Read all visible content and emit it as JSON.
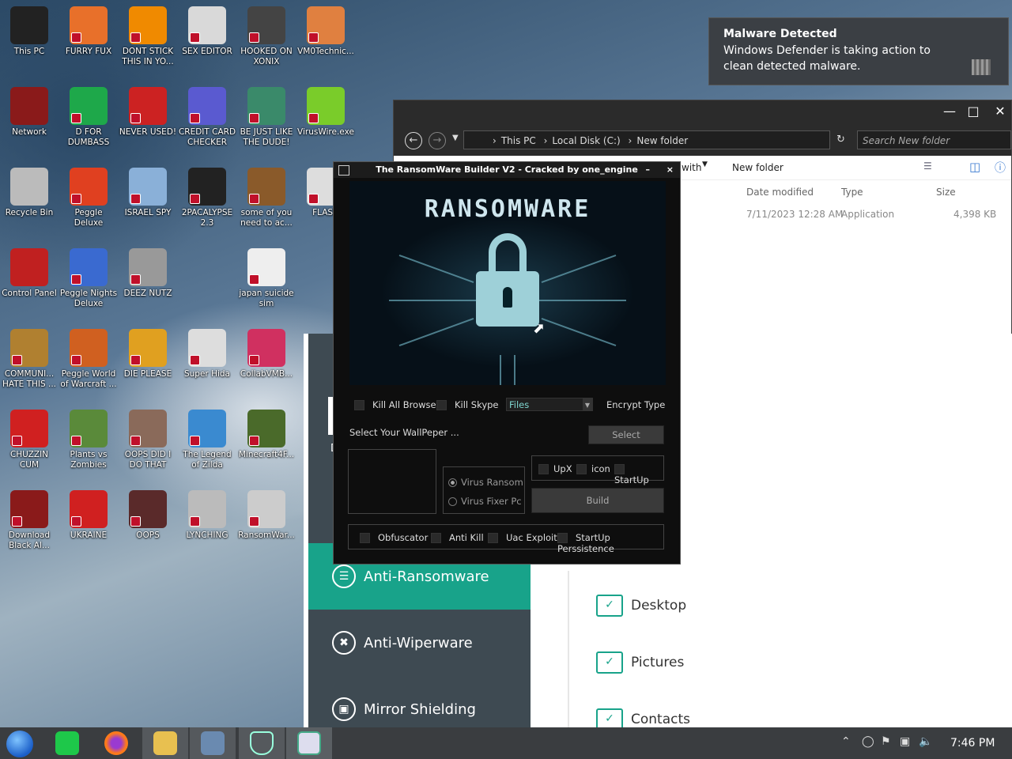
{
  "desktop_icons": [
    {
      "label": "This PC",
      "color": "#222"
    },
    {
      "label": "FURRY FUX",
      "color": "#e8702a"
    },
    {
      "label": "DONT STICK THIS IN YO...",
      "color": "#f08a00"
    },
    {
      "label": "SEX EDITOR",
      "color": "#d9d9d9"
    },
    {
      "label": "HOOKED ON XONIX",
      "color": "#444"
    },
    {
      "label": "VM0Technic...",
      "color": "#e08040"
    },
    {
      "label": "Network",
      "color": "#8a1a1a"
    },
    {
      "label": "D FOR DUMBASS",
      "color": "#1ea84a"
    },
    {
      "label": "NEVER USED!",
      "color": "#cc2222"
    },
    {
      "label": "CREDIT CARD CHECKER",
      "color": "#5a5ad0"
    },
    {
      "label": "BE JUST LIKE THE DUDE!",
      "color": "#3a8a6a"
    },
    {
      "label": "VirusWire.exe",
      "color": "#7acc2a"
    },
    {
      "label": "Recycle Bin",
      "color": "#bbb"
    },
    {
      "label": "Peggle Deluxe",
      "color": "#e04020"
    },
    {
      "label": "ISRAEL SPY",
      "color": "#8ab0d8"
    },
    {
      "label": "2PACALYPSE 2.3",
      "color": "#222"
    },
    {
      "label": "some of you need to ac...",
      "color": "#8a5a2a"
    },
    {
      "label": "FLASH",
      "color": "#ddd"
    },
    {
      "label": "Control Panel",
      "color": "#c02020"
    },
    {
      "label": "Peggle Nights Deluxe",
      "color": "#3a6ad0"
    },
    {
      "label": "DEEZ NUTZ",
      "color": "#999"
    },
    {
      "label": "japan suicide sim",
      "color": "#eee"
    },
    {
      "label": "COMMUNI... HATE THIS ...",
      "color": "#b08030"
    },
    {
      "label": "Peggle World of Warcraft ...",
      "color": "#d06020"
    },
    {
      "label": "DIE PLEASE",
      "color": "#e0a020"
    },
    {
      "label": "Super Hida",
      "color": "#ddd"
    },
    {
      "label": "CollabVMB...",
      "color": "#d03060"
    },
    {
      "label": "CHUZZIN CUM",
      "color": "#d02020"
    },
    {
      "label": "Plants vs Zombies",
      "color": "#5a8a3a"
    },
    {
      "label": "OOPS DID I DO THAT",
      "color": "#8a6a5a"
    },
    {
      "label": "The Legend of Zilda",
      "color": "#3a8ad0"
    },
    {
      "label": "Minecraft4F...",
      "color": "#4a6a2a"
    },
    {
      "label": "Download Black Al...",
      "color": "#8a1a1a"
    },
    {
      "label": "UKRAINE",
      "color": "#d02020"
    },
    {
      "label": "OOPS",
      "color": "#5a2a2a"
    },
    {
      "label": "LYNCHING",
      "color": "#bbb"
    },
    {
      "label": "RansomWar...",
      "color": "#ccc"
    }
  ],
  "toast": {
    "title": "Malware Detected",
    "body": "Windows Defender is taking action to clean detected malware."
  },
  "explorer": {
    "path": [
      "This PC",
      "Local Disk (C:)",
      "New folder"
    ],
    "search_placeholder": "Search New folder",
    "cmd_with": "with",
    "cmd_newfolder": "New folder",
    "columns": {
      "date": "Date modified",
      "type": "Type",
      "size": "Size"
    },
    "file": {
      "date": "7/11/2023 12:28 AM",
      "type": "Application",
      "size": "4,398 KB"
    }
  },
  "defender": {
    "sidebar": [
      {
        "label": "Anti-Ransomware",
        "icon": "document-shield-icon"
      },
      {
        "label": "Anti-Wiperware",
        "icon": "wiper-icon"
      },
      {
        "label": "Mirror Shielding",
        "icon": "mirror-icon"
      }
    ],
    "cut_label": "D",
    "folders": [
      "Desktop",
      "Pictures",
      "Contacts"
    ]
  },
  "ransomware": {
    "title": "The RansomWare Builder V2 - Cracked by one_engine",
    "banner_title": "RANSOMWARE",
    "kill_all_browser": "Kill All Browser",
    "kill_skype": "Kill Skype",
    "files_value": "Files",
    "encrypt_type": "Encrypt Type",
    "select_wallpaper": "Select Your WallPeper ...",
    "select_btn": "Select",
    "virus_ransom": "Virus Ransom",
    "virus_fixer": "Virus Fixer Pc",
    "upx": "UpX",
    "icon": "icon",
    "startup": "StartUp",
    "build": "Build",
    "obfuscator": "Obfuscator",
    "anti_kill": "Anti Kill",
    "uac_exploit": "Uac Exploit",
    "startup_persistence": "StartUp Perssistence"
  },
  "taskbar": {
    "clock": "7:46 PM"
  }
}
